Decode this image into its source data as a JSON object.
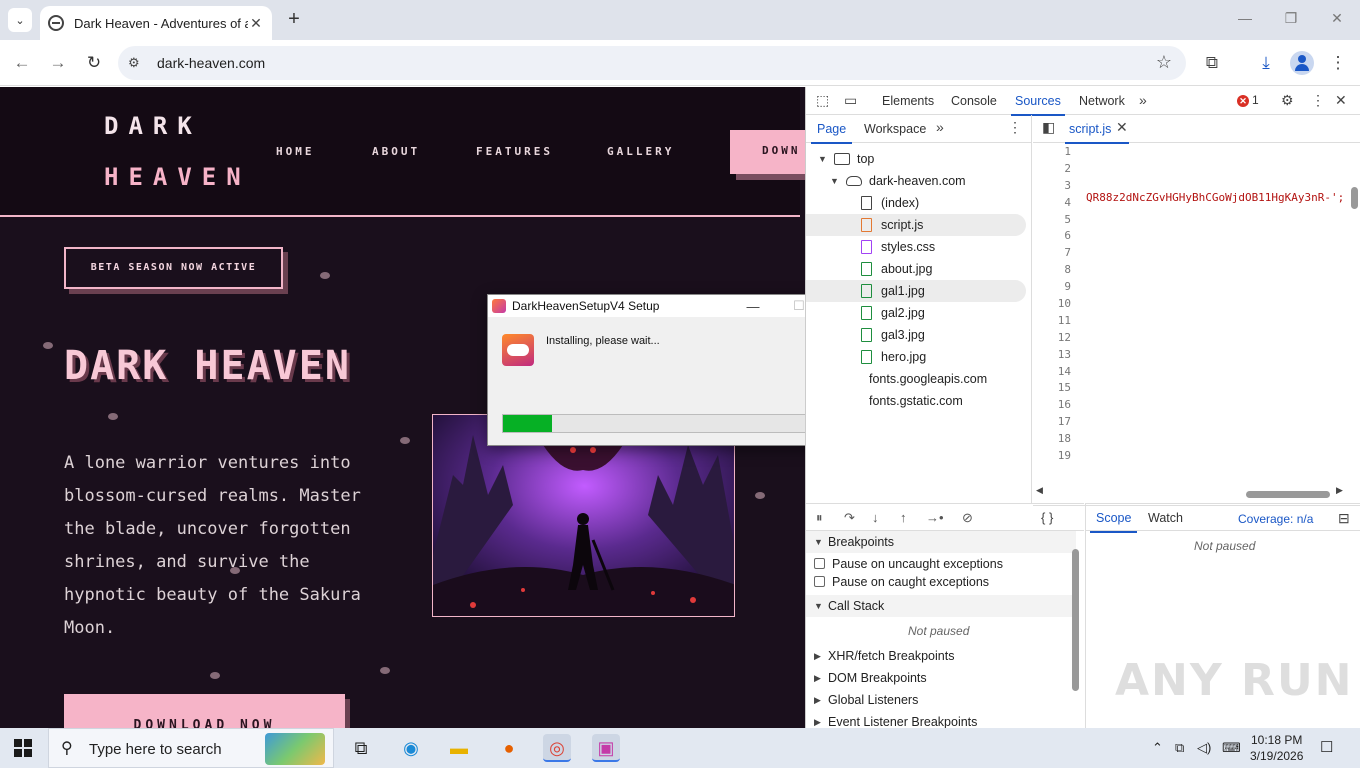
{
  "browser": {
    "tab_title": "Dark Heaven - Adventures of a",
    "url": "dark-heaven.com"
  },
  "site": {
    "logo_line1": "DARK",
    "logo_line2": "HEAVEN",
    "nav": [
      "HOME",
      "ABOUT",
      "FEATURES",
      "GALLERY"
    ],
    "header_cta": "DOWN",
    "beta_badge": "BETA SEASON NOW ACTIVE",
    "hero_title": "DARK HEAVEN",
    "hero_text": "A lone warrior ventures into blossom-cursed realms. Master the blade, uncover forgotten shrines, and survive the hypnotic beauty of the Sakura Moon.",
    "download_cta": "DOWNLOAD NOW"
  },
  "installer": {
    "title": "DarkHeavenSetupV4 Setup",
    "app_icon_text": "GAME",
    "message": "Installing, please wait...",
    "progress": 0.14,
    "minimize": "—",
    "maximize": "☐",
    "close": "✕"
  },
  "devtools": {
    "tabs": [
      "Elements",
      "Console",
      "Sources",
      "Network"
    ],
    "active_tab": "Sources",
    "error_count": "1",
    "nav_tabs": [
      "Page",
      "Workspace"
    ],
    "tree": {
      "top": "top",
      "domain": "dark-heaven.com",
      "files": [
        "(index)",
        "script.js",
        "styles.css",
        "about.jpg",
        "gal1.jpg",
        "gal2.jpg",
        "gal3.jpg",
        "hero.jpg"
      ],
      "other_domains": [
        "fonts.googleapis.com",
        "fonts.gstatic.com"
      ]
    },
    "editor": {
      "open_file": "script.js",
      "line_numbers": [
        "1",
        "2",
        "3",
        "4",
        "5",
        "6",
        "7",
        "8",
        "9",
        "10",
        "11",
        "12",
        "13",
        "14",
        "15",
        "16",
        "17",
        "18",
        "19"
      ],
      "line2": "QR88z2dNcZGvHGHyBhCGoWjdOB11HgKAy3nR-';",
      "coverage": "Coverage: n/a"
    },
    "debugger": {
      "breakpoints_label": "Breakpoints",
      "pause_uncaught": "Pause on uncaught exceptions",
      "pause_caught": "Pause on caught exceptions",
      "call_stack_label": "Call Stack",
      "not_paused": "Not paused",
      "sections": [
        "XHR/fetch Breakpoints",
        "DOM Breakpoints",
        "Global Listeners",
        "Event Listener Breakpoints"
      ],
      "scope_tabs": [
        "Scope",
        "Watch"
      ]
    }
  },
  "taskbar": {
    "search_placeholder": "Type here to search",
    "time": "10:18 PM",
    "date": "3/19/2026"
  },
  "watermark": "ANY RUN"
}
